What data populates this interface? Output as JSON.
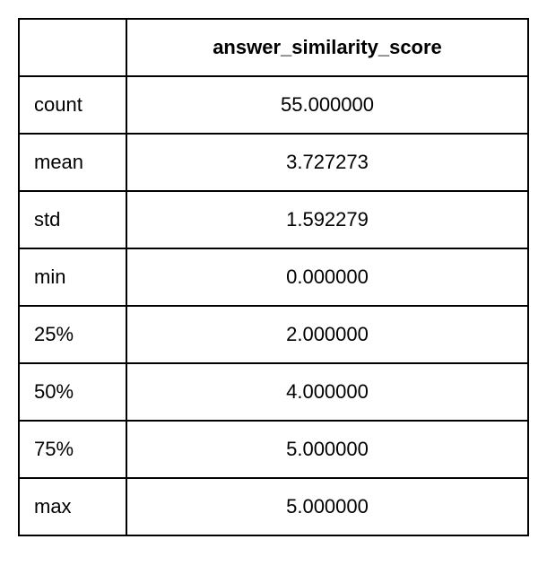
{
  "chart_data": {
    "type": "table",
    "title": "",
    "column_header": "answer_similarity_score",
    "rows": [
      {
        "label": "count",
        "value": "55.000000"
      },
      {
        "label": "mean",
        "value": "3.727273"
      },
      {
        "label": "std",
        "value": "1.592279"
      },
      {
        "label": "min",
        "value": "0.000000"
      },
      {
        "label": "25%",
        "value": "2.000000"
      },
      {
        "label": "50%",
        "value": "4.000000"
      },
      {
        "label": "75%",
        "value": "5.000000"
      },
      {
        "label": "max",
        "value": "5.000000"
      }
    ]
  }
}
